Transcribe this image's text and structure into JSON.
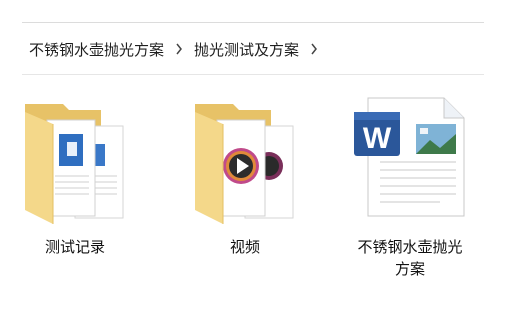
{
  "breadcrumb": {
    "items": [
      "不锈钢水壶抛光方案",
      "抛光测试及方案"
    ]
  },
  "files": [
    {
      "name_line1": "测试记录",
      "name_line2": "",
      "type": "folder",
      "preview": "document-pages"
    },
    {
      "name_line1": "视频",
      "name_line2": "",
      "type": "folder",
      "preview": "video-play"
    },
    {
      "name_line1": "不锈钢水壶抛光",
      "name_line2": "方案",
      "type": "word-document"
    }
  ],
  "colors": {
    "folder_back": "#e7c267",
    "folder_front": "#f4d88a",
    "word_blue": "#2b579a",
    "separator": "#dcdcdc"
  }
}
